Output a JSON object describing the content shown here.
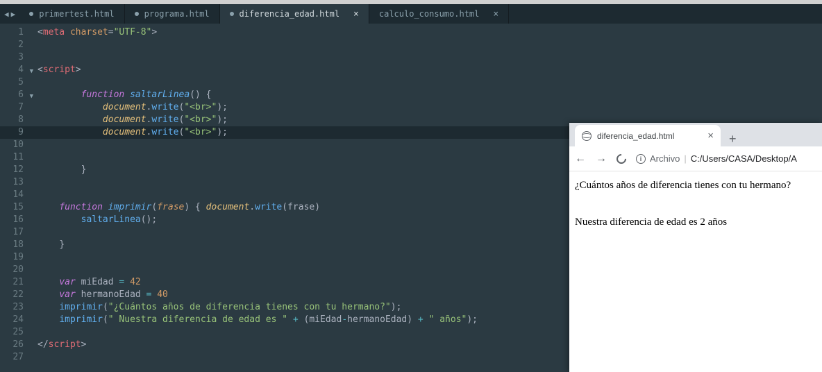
{
  "tabs": [
    {
      "label": "primertest.html"
    },
    {
      "label": "programa.html"
    },
    {
      "label": "diferencia_edad.html"
    },
    {
      "label": "calculo_consumo.html"
    }
  ],
  "activeTab": 2,
  "gutter": {
    "lines": [
      "1",
      "2",
      "3",
      "4",
      "5",
      "6",
      "7",
      "8",
      "9",
      "10",
      "11",
      "12",
      "13",
      "14",
      "15",
      "16",
      "17",
      "18",
      "19",
      "20",
      "21",
      "22",
      "23",
      "24",
      "25",
      "26",
      "27"
    ],
    "highlighted": 9,
    "folds": [
      4,
      6
    ]
  },
  "code": {
    "l1": {
      "a": "<",
      "b": "meta ",
      "c": "charset",
      "d": "=",
      "e": "\"UTF-8\"",
      "f": ">"
    },
    "l4": {
      "a": "<",
      "b": "script",
      "c": ">"
    },
    "l6": {
      "a": "function",
      "b": " saltarLinea",
      "c": "() {"
    },
    "l7": {
      "a": "document",
      "b": ".",
      "c": "write",
      "d": "(",
      "e": "\"<br>\"",
      "f": ");"
    },
    "l8": {
      "a": "document",
      "b": ".",
      "c": "write",
      "d": "(",
      "e": "\"<br>\"",
      "f": ");"
    },
    "l9": {
      "a": "document",
      "b": ".",
      "c": "write",
      "d": "(",
      "e": "\"<br>\"",
      "f": ");"
    },
    "l12": {
      "a": "}"
    },
    "l15": {
      "a": "function",
      "b": " imprimir",
      "c": "(",
      "d": "frase",
      "e": ") { ",
      "f": "document",
      "g": ".",
      "h": "write",
      "i": "(frase)"
    },
    "l16": {
      "a": "saltarLinea",
      "b": "();"
    },
    "l18": {
      "a": "}"
    },
    "l21": {
      "a": "var",
      "b": " miEdad ",
      "c": "=",
      "d": " 42"
    },
    "l22": {
      "a": "var",
      "b": " hermanoEdad ",
      "c": "=",
      "d": " 40"
    },
    "l23": {
      "a": "imprimir",
      "b": "(",
      "c": "\"¿Cuántos años de diferencia tienes con tu hermano?\"",
      "d": ");"
    },
    "l24": {
      "a": "imprimir",
      "b": "(",
      "c": "\" Nuestra diferencia de edad es \"",
      "d": " + ",
      "e": "(miEdad",
      "f": "-",
      "g": "hermanoEdad) ",
      "h": "+ ",
      "i": "\" años\"",
      "j": ");"
    },
    "l26": {
      "a": "</",
      "b": "script",
      "c": ">"
    }
  },
  "browser": {
    "tabTitle": "diferencia_edad.html",
    "urlLabel": "Archivo",
    "urlPath": "C:/Users/CASA/Desktop/A",
    "line1": "¿Cuántos años de diferencia tienes con tu hermano?",
    "line2": " Nuestra diferencia de edad es 2 años"
  }
}
